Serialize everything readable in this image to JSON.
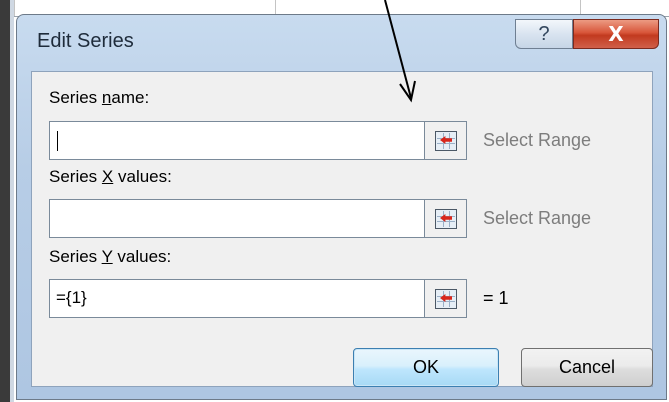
{
  "dialog": {
    "title": "Edit Series",
    "help_glyph": "?",
    "close_glyph": "X"
  },
  "fields": {
    "series_name": {
      "label_pre": "Series ",
      "label_accel": "n",
      "label_post": "ame:",
      "value": "",
      "hint": "Select Range"
    },
    "series_x": {
      "label_pre": "Series ",
      "label_accel": "X",
      "label_post": " values:",
      "value": "",
      "hint": "Select Range"
    },
    "series_y": {
      "label_pre": "Series ",
      "label_accel": "Y",
      "label_post": " values:",
      "value": "={1}",
      "hint": "= 1"
    }
  },
  "buttons": {
    "ok": "OK",
    "cancel": "Cancel"
  },
  "colors": {
    "title_bar": "#b7cde6",
    "close_button": "#c23a1f",
    "ok_border": "#3c7fb1",
    "hint_text": "#7d7d7d",
    "range_icon_arrow": "#d8261c"
  },
  "icons": {
    "range_selector": "collapse-dialog-range-icon",
    "annotation": "pointer-arrow"
  }
}
